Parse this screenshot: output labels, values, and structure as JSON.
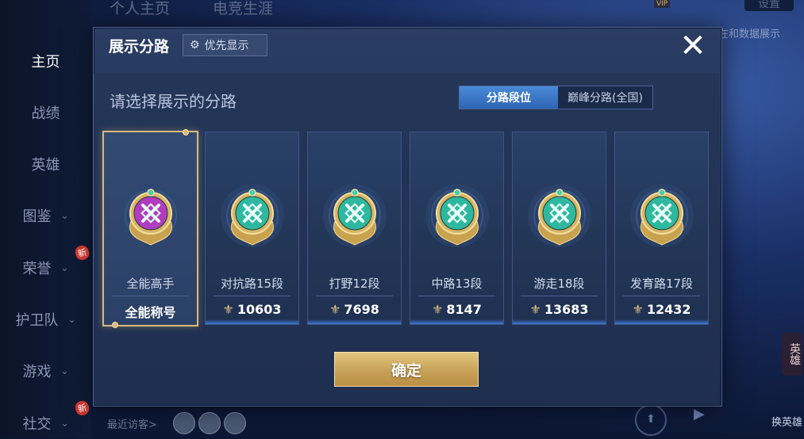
{
  "top_tabs": [
    "个人主页",
    "电竞生涯"
  ],
  "header": {
    "settings_label": "设置",
    "vip_label": "VIP",
    "data_display_text": "在和数据展示"
  },
  "nav": {
    "items": [
      {
        "label": "主页",
        "active": true,
        "chevron": false,
        "new_badge": false
      },
      {
        "label": "战绩",
        "active": false,
        "chevron": false,
        "new_badge": false
      },
      {
        "label": "英雄",
        "active": false,
        "chevron": false,
        "new_badge": false
      },
      {
        "label": "图鉴",
        "active": false,
        "chevron": true,
        "new_badge": false
      },
      {
        "label": "荣誉",
        "active": false,
        "chevron": true,
        "new_badge": true
      },
      {
        "label": "护卫队",
        "active": false,
        "chevron": true,
        "new_badge": false
      },
      {
        "label": "游戏",
        "active": false,
        "chevron": true,
        "new_badge": false
      },
      {
        "label": "社交",
        "active": false,
        "chevron": true,
        "new_badge": true
      }
    ],
    "new_badge_text": "新"
  },
  "bottom": {
    "visitors_label": "最近访客>",
    "hero_swap_label": "换英雄",
    "hero_icon_text": "英雄"
  },
  "dialog": {
    "title": "展示分路",
    "priority_label": "优先显示",
    "close_icon": "close-icon",
    "select_title": "请选择展示的分路",
    "segments": [
      {
        "label": "分路段位",
        "active": true
      },
      {
        "label": "巅峰分路(全国)",
        "active": false
      }
    ],
    "cards": [
      {
        "role": "全能高手",
        "score": "全能称号",
        "selected": true,
        "badge_color": "#b03cc0",
        "icon": "all-round-icon"
      },
      {
        "role": "对抗路15段",
        "score": "10603",
        "selected": false,
        "badge_color": "#2fb8a0",
        "icon": "clash-lane-icon"
      },
      {
        "role": "打野12段",
        "score": "7698",
        "selected": false,
        "badge_color": "#2fb8a0",
        "icon": "jungle-icon"
      },
      {
        "role": "中路13段",
        "score": "8147",
        "selected": false,
        "badge_color": "#2fb8a0",
        "icon": "mid-lane-icon"
      },
      {
        "role": "游走18段",
        "score": "13683",
        "selected": false,
        "badge_color": "#2fb8a0",
        "icon": "roam-icon"
      },
      {
        "role": "发育路17段",
        "score": "12432",
        "selected": false,
        "badge_color": "#2fb8a0",
        "icon": "farm-lane-icon"
      }
    ],
    "confirm_label": "确定"
  },
  "colors": {
    "gold": "#d9b878",
    "accent_blue": "#3d7ad6",
    "teal_badge": "#2fb8a0",
    "purple_badge": "#b03cc0"
  }
}
